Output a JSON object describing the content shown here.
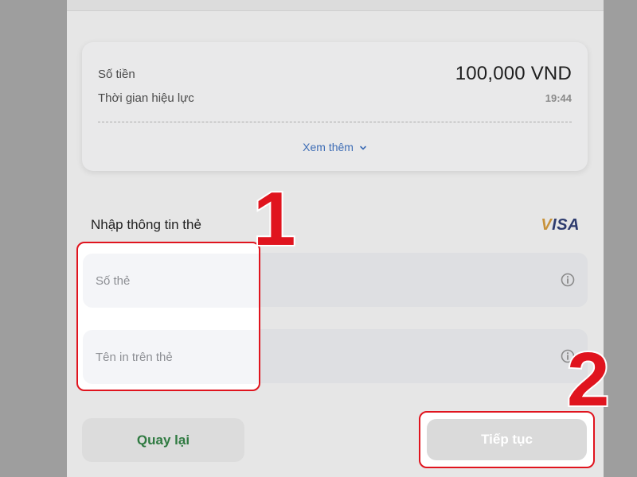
{
  "summary": {
    "amount_label": "Số tiền",
    "amount_value": "100,000 VND",
    "validity_label": "Thời gian hiệu lực",
    "validity_value": "19:44",
    "more_label": "Xem thêm"
  },
  "card_form": {
    "title": "Nhập thông tin thẻ",
    "brand": {
      "part1": "V",
      "part2": "ISA"
    },
    "card_number_placeholder": "Số thẻ",
    "card_name_placeholder": "Tên in trên thẻ"
  },
  "actions": {
    "back_label": "Quay lại",
    "next_label": "Tiếp tục"
  },
  "annotations": {
    "step_1": "1",
    "step_2": "2"
  },
  "colors": {
    "highlight": "#e0141e",
    "link": "#3e6db5",
    "back_text": "#2f7a41"
  },
  "icons": {
    "info": "info-icon",
    "more": "chevron-down-icon"
  }
}
